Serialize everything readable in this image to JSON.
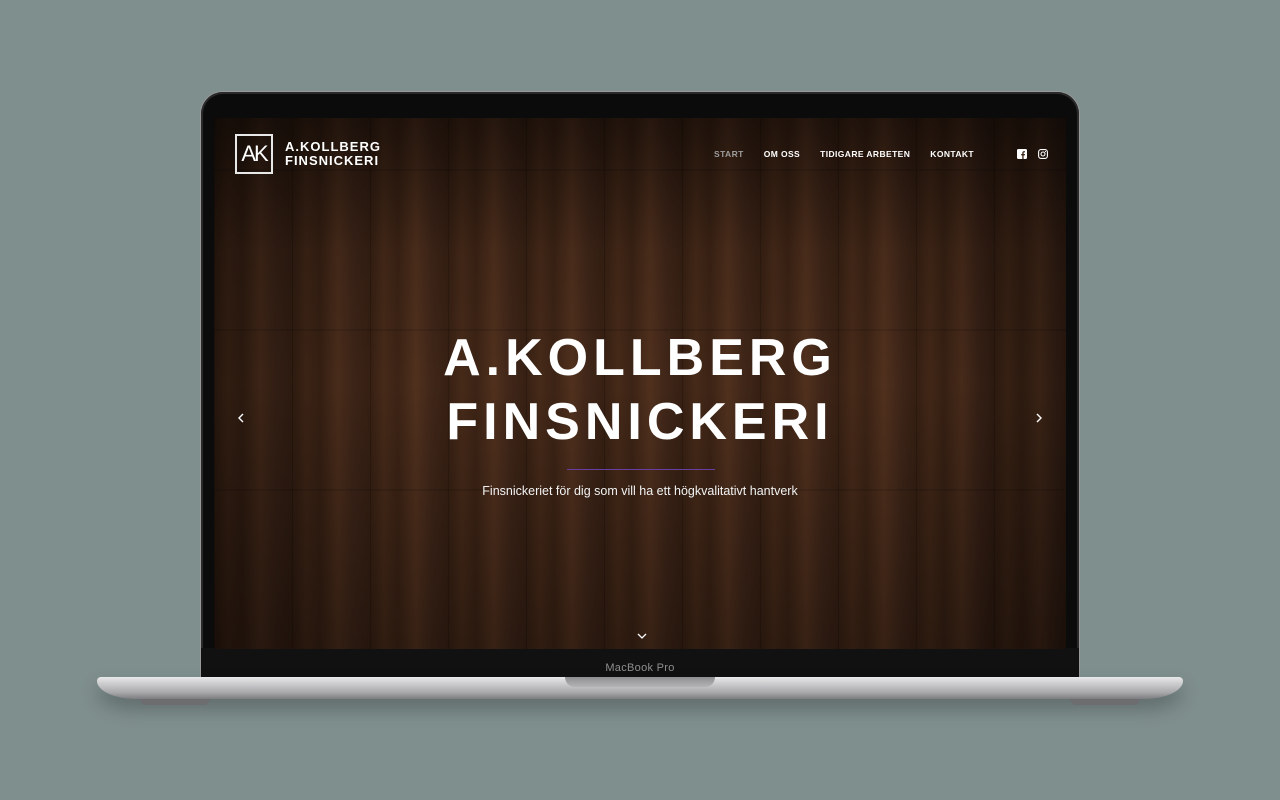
{
  "device": {
    "model_label": "MacBook Pro"
  },
  "site": {
    "logo": {
      "mark": "AK",
      "line1": "A.KOLLBERG",
      "line2": "FINSNICKERI"
    },
    "nav": [
      {
        "label": "START",
        "active": true
      },
      {
        "label": "OM OSS",
        "active": false
      },
      {
        "label": "TIDIGARE ARBETEN",
        "active": false
      },
      {
        "label": "KONTAKT",
        "active": false
      }
    ],
    "social": [
      "facebook-icon",
      "instagram-icon"
    ],
    "hero": {
      "title_line1": "A.KOLLBERG",
      "title_line2": "FINSNICKERI",
      "subtitle": "Finsnickeriet för dig som vill ha ett högkvalitativt hantverk"
    }
  },
  "colors": {
    "background": "#7f8f8e",
    "accent_rule": "#6a3ea0",
    "nav_active": "#9c9c9c",
    "wood": "#3f2617"
  }
}
